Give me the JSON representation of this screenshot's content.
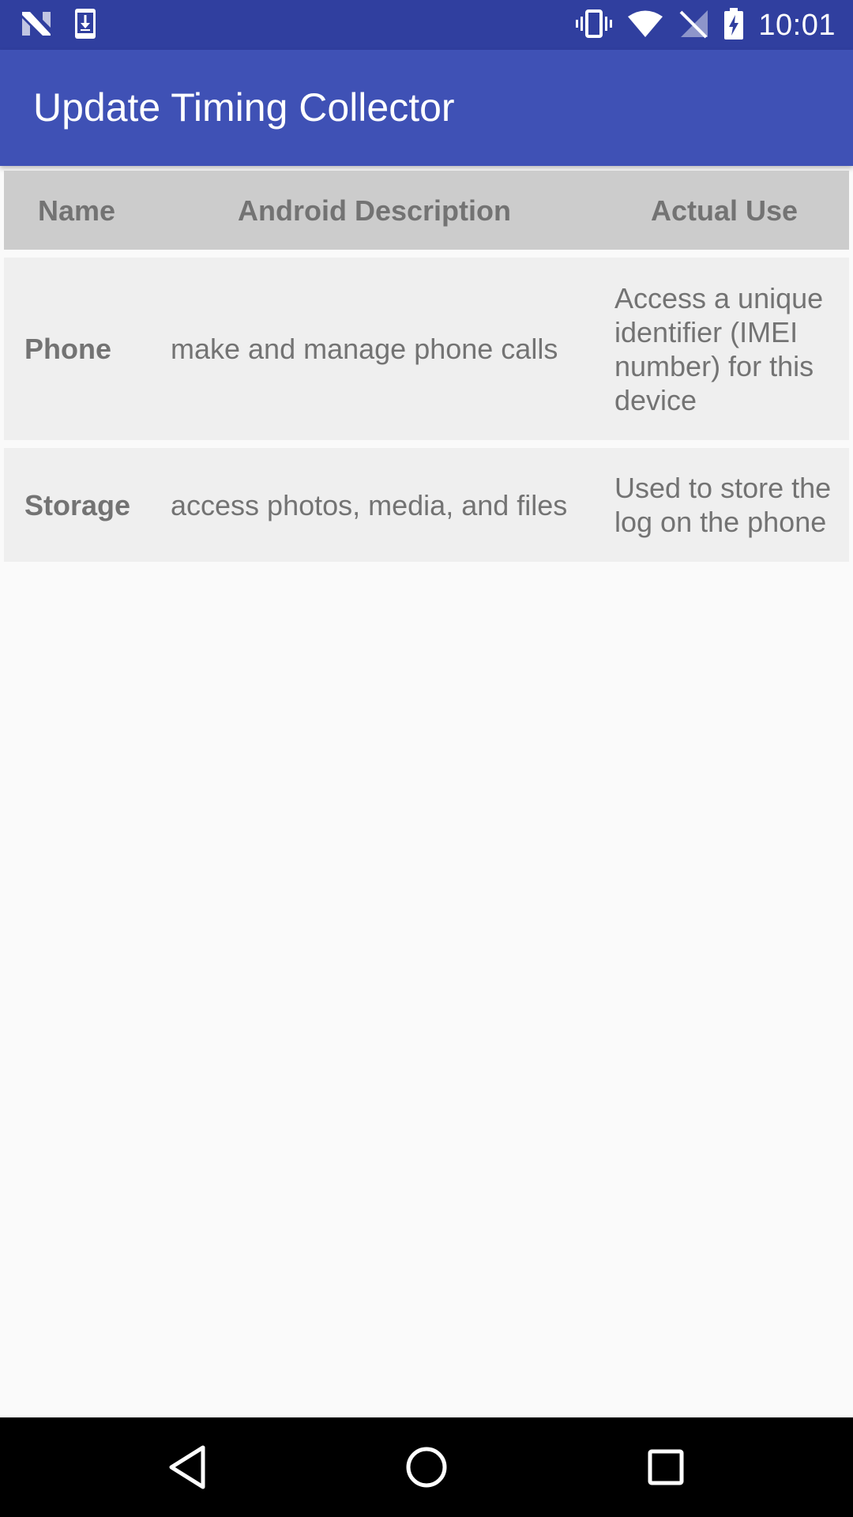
{
  "status_bar": {
    "time": "10:01",
    "left_icons": [
      "n-logo-icon",
      "download-icon"
    ],
    "right_icons": [
      "vibrate-icon",
      "wifi-icon",
      "no-signal-icon",
      "battery-charging-icon"
    ]
  },
  "app_bar": {
    "title": "Update Timing Collector"
  },
  "table": {
    "headers": [
      "Name",
      "Android Description",
      "Actual Use"
    ],
    "rows": [
      {
        "name": "Phone",
        "description": "make and manage phone calls",
        "use": "Access a unique identifier (IMEI number) for this device"
      },
      {
        "name": "Storage",
        "description": "access photos, media, and files",
        "use": "Used to store the log on the phone"
      }
    ]
  },
  "nav_bar": {
    "buttons": [
      "back-icon",
      "home-icon",
      "recents-icon"
    ]
  },
  "colors": {
    "status_bar": "#303f9f",
    "app_bar": "#3f51b5",
    "header_row": "#cccccc",
    "data_row": "#efefef",
    "text": "#737373"
  }
}
